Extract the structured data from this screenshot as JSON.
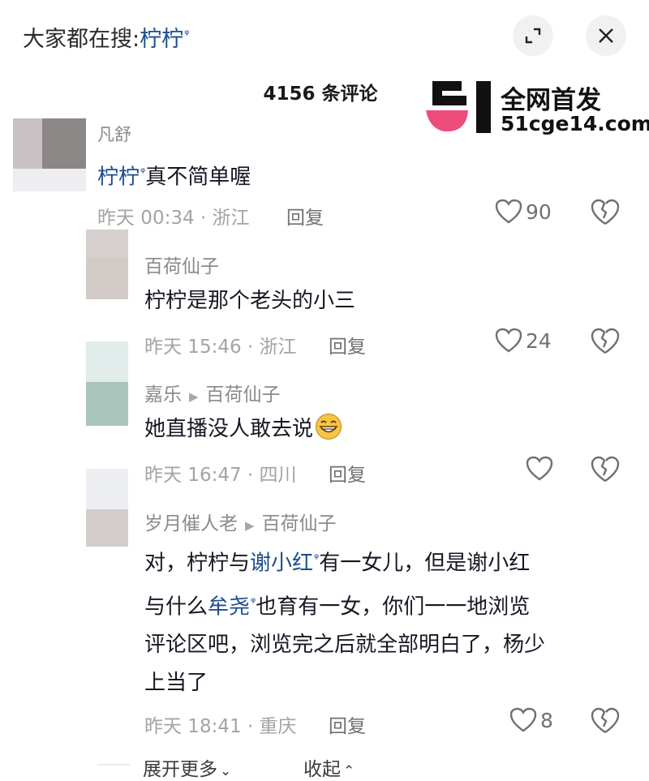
{
  "header": {
    "search_prefix": "大家都在搜:",
    "search_keyword": "柠柠",
    "search_glyph": "ᵠ",
    "expand_icon": "expand-icon",
    "close_icon": "close-icon"
  },
  "comment_count": "4156 条评论",
  "watermark": {
    "line1": "全网首发",
    "line2": "51cge14.com"
  },
  "comments": [
    {
      "user": "凡舒",
      "text_keyword": "柠柠",
      "text_rest": "真不简单喔",
      "meta": "昨天 00:34 · 浙江",
      "reply_label": "回复",
      "likes": "90"
    },
    {
      "user": "百荷仙子",
      "text": "柠柠是那个老头的小三",
      "meta": "昨天 15:46 · 浙江",
      "reply_label": "回复",
      "likes": "24"
    },
    {
      "user": "嘉乐",
      "reply_to": "百荷仙子",
      "text": "她直播没人敢去说",
      "meta": "昨天 16:47 · 四川",
      "reply_label": "回复",
      "likes": ""
    },
    {
      "user": "岁月催人老",
      "reply_to": "百荷仙子",
      "line1_a": "对，柠柠与",
      "line1_kw": "谢小红",
      "line1_b": "有一女儿，但是谢小红",
      "line2_a": "与什么",
      "line2_kw": "牟尧",
      "line2_b": "也育有一女，你们一一地浏览",
      "line3": "评论区吧，浏览完之后就全部明白了，杨少",
      "line4": "上当了",
      "meta": "昨天 18:41 · 重庆",
      "reply_label": "回复",
      "likes": "8"
    }
  ],
  "footer": {
    "expand_more": "展开更多",
    "collapse": "收起"
  },
  "colors": {
    "keyword": "#1c4d8c",
    "logo_pink": "#ee4c7a",
    "meta": "#a3a3a8"
  }
}
